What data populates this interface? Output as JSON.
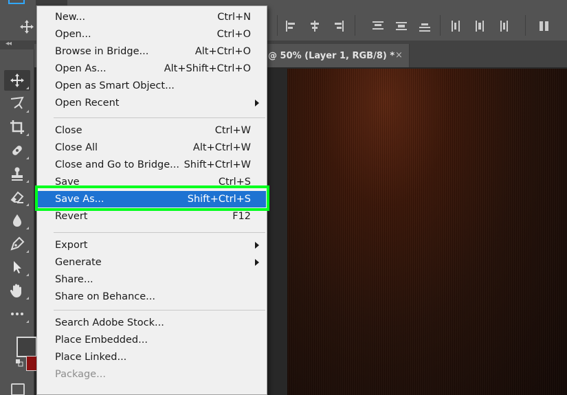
{
  "colors": {
    "ui_bg": "#535353",
    "menu_bg": "#f0f0f0",
    "highlight_blue": "#1e73d2",
    "callout_green": "#00ff1e"
  },
  "document_tab": {
    "title": "@ 50% (Layer 1, RGB/8) *",
    "close": "×"
  },
  "file_menu": {
    "groups": [
      [
        {
          "label": "New...",
          "shortcut": "Ctrl+N"
        },
        {
          "label": "Open...",
          "shortcut": "Ctrl+O"
        },
        {
          "label": "Browse in Bridge...",
          "shortcut": "Alt+Ctrl+O"
        },
        {
          "label": "Open As...",
          "shortcut": "Alt+Shift+Ctrl+O"
        },
        {
          "label": "Open as Smart Object...",
          "shortcut": ""
        },
        {
          "label": "Open Recent",
          "shortcut": "",
          "submenu": true
        }
      ],
      [
        {
          "label": "Close",
          "shortcut": "Ctrl+W"
        },
        {
          "label": "Close All",
          "shortcut": "Alt+Ctrl+W"
        },
        {
          "label": "Close and Go to Bridge...",
          "shortcut": "Shift+Ctrl+W"
        },
        {
          "label": "Save",
          "shortcut": "Ctrl+S"
        },
        {
          "label": "Save As...",
          "shortcut": "Shift+Ctrl+S",
          "highlighted": true
        },
        {
          "label": "Revert",
          "shortcut": "F12"
        }
      ],
      [
        {
          "label": "Export",
          "shortcut": "",
          "submenu": true
        },
        {
          "label": "Generate",
          "shortcut": "",
          "submenu": true
        },
        {
          "label": "Share...",
          "shortcut": ""
        },
        {
          "label": "Share on Behance...",
          "shortcut": ""
        }
      ],
      [
        {
          "label": "Search Adobe Stock...",
          "shortcut": ""
        },
        {
          "label": "Place Embedded...",
          "shortcut": ""
        },
        {
          "label": "Place Linked...",
          "shortcut": ""
        },
        {
          "label": "Package...",
          "shortcut": "",
          "disabled": true
        }
      ]
    ]
  },
  "toolbar": {
    "tools": [
      "move-icon",
      "lasso-icon",
      "crop-icon",
      "healing-brush-icon",
      "stamp-icon",
      "eraser-icon",
      "blur-drop-icon",
      "pen-icon",
      "path-selection-icon",
      "hand-icon",
      "more-tools-icon"
    ]
  }
}
